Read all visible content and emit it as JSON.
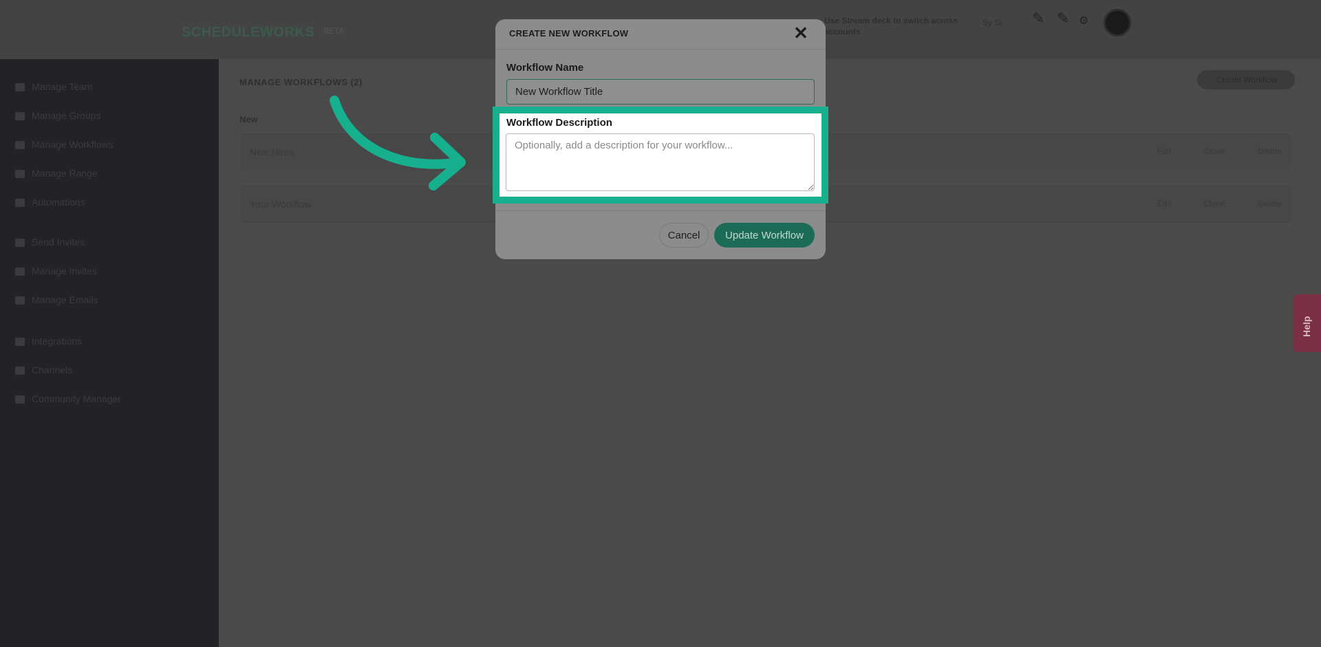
{
  "colors": {
    "accent": "#17b08e",
    "overlay_bg": "#4a4a4a",
    "primary_button": "#1b6b57",
    "help_tab": "#7a2f44"
  },
  "header": {
    "logo": "SCHEDULEWORKS",
    "logo_tag": "BETA",
    "notice": "Use Stream deck to switch across accounts",
    "user": "Sy Sr"
  },
  "sidebar": {
    "items": [
      {
        "label": "Manage Team",
        "icon": "user-icon"
      },
      {
        "label": "Manage Groups",
        "icon": "group-icon"
      },
      {
        "label": "Manage Workflows",
        "icon": "workflow-icon"
      },
      {
        "label": "Manage Range",
        "icon": "range-icon"
      },
      {
        "label": "Automations",
        "icon": "gear-icon"
      },
      {
        "label": "Send Invites",
        "icon": "send-icon"
      },
      {
        "label": "Manage Invites",
        "icon": "chart-icon"
      },
      {
        "label": "Manage Emails",
        "icon": "mail-icon"
      },
      {
        "label": "Integrations",
        "icon": "plug-icon"
      },
      {
        "label": "Channels",
        "icon": "channel-icon"
      },
      {
        "label": "Community Manager",
        "icon": "phone-icon"
      }
    ]
  },
  "main": {
    "title": "MANAGE WORKFLOWS (2)",
    "create_button": "Create Workflow",
    "section_label": "New",
    "workflows": [
      {
        "name": "New Hires",
        "actions": "Edit Clone Delete"
      },
      {
        "name": "Your Workflow",
        "actions": "Edit Clone Delete"
      }
    ]
  },
  "help": {
    "label": "Help"
  },
  "modal": {
    "title": "CREATE NEW WORKFLOW",
    "close_label": "✕",
    "name_label": "Workflow Name",
    "name_value": "New Workflow Title",
    "description_label": "Workflow Description",
    "description_placeholder": "Optionally, add a description for your workflow...",
    "description_value": "",
    "cancel_label": "Cancel",
    "submit_label": "Update Workflow"
  }
}
